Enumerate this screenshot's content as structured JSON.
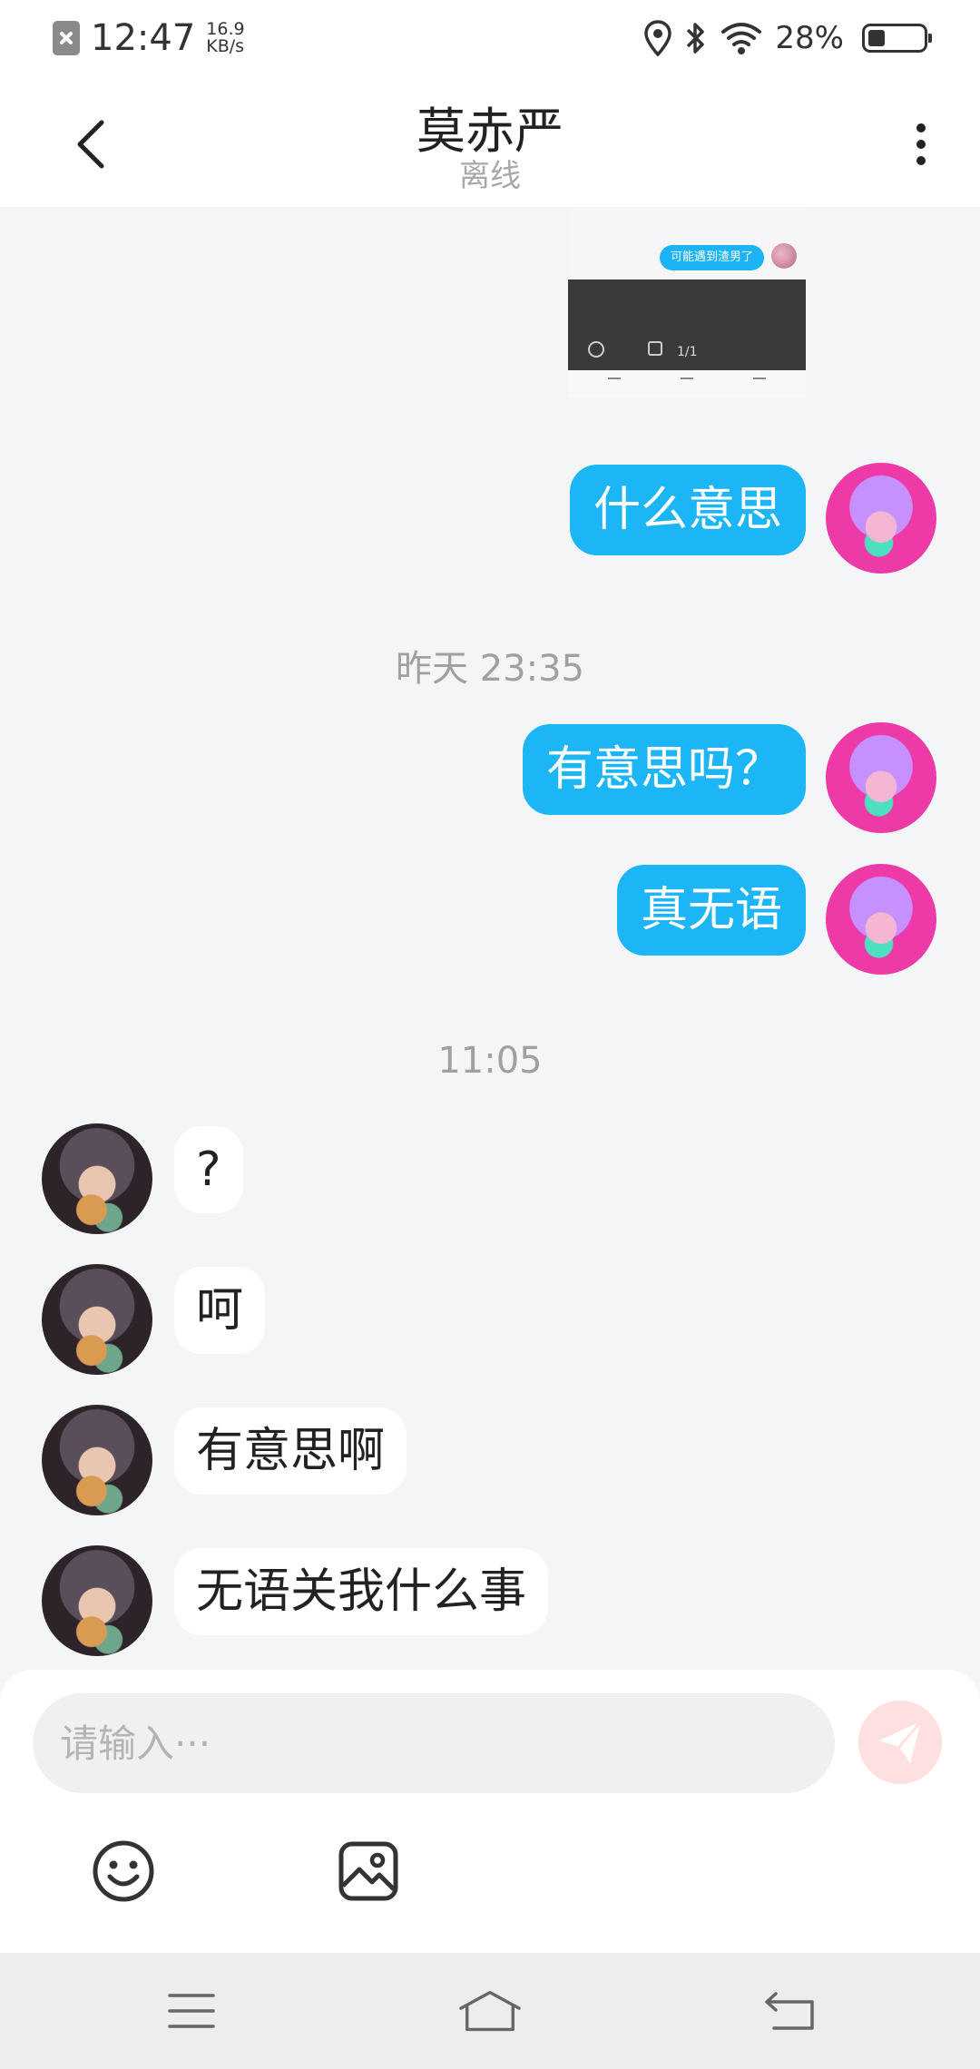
{
  "status_bar": {
    "time": "12:47",
    "speed_value": "16.9",
    "speed_unit": "KB/s",
    "battery_percent": "28%",
    "icons": [
      "sim-off-icon",
      "location-icon",
      "bluetooth-icon",
      "wifi-icon",
      "battery-icon"
    ]
  },
  "header": {
    "name": "莫赤严",
    "status": "离线",
    "icons": [
      "back-arrow-icon",
      "more-vertical-icon"
    ]
  },
  "shared_image": {
    "bubble_text": "可能遇到渣男了",
    "page_indicator": "1/1"
  },
  "messages": [
    {
      "type": "out",
      "text": "什么意思"
    },
    {
      "type": "time",
      "text": "昨天 23:35"
    },
    {
      "type": "out",
      "text": "有意思吗？"
    },
    {
      "type": "out",
      "text": "真无语"
    },
    {
      "type": "time",
      "text": "11:05"
    },
    {
      "type": "in",
      "text": "?"
    },
    {
      "type": "in",
      "text": "呵"
    },
    {
      "type": "in",
      "text": "有意思啊"
    },
    {
      "type": "in",
      "text": "无语关我什么事"
    }
  ],
  "composer": {
    "placeholder": "请输入···",
    "icons": [
      "send-icon",
      "emoji-icon",
      "image-icon"
    ],
    "send_color": "#fde0df"
  },
  "nav_bar": {
    "icons": [
      "menu-icon",
      "home-icon",
      "back-icon"
    ]
  },
  "colors": {
    "bubble_out": "#1cb5f5",
    "bubble_in": "#ffffff",
    "background": "#f4f5f7"
  }
}
